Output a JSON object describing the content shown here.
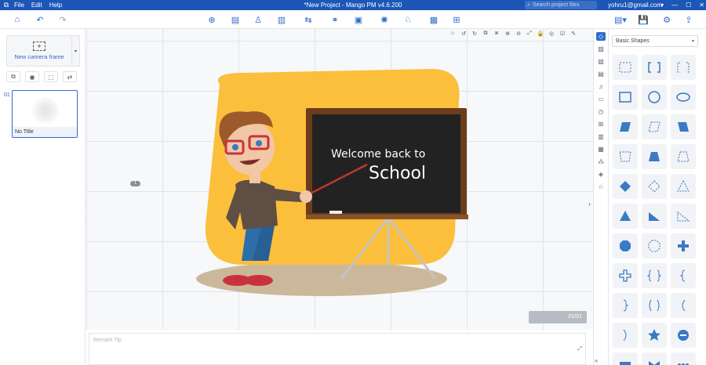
{
  "titlebar": {
    "menu": [
      "File",
      "Edit",
      "Help"
    ],
    "title": "*New Project - Mango PM  v4.6.200",
    "search_placeholder": "Search project files",
    "email": "yohru1@gmail.com"
  },
  "left_panel": {
    "new_camera_frame": "New camera frame",
    "slide_number": "01",
    "slide_title": "No Title"
  },
  "canvas": {
    "marker": "1",
    "page_counter": "01/01",
    "blackboard_line1": "Welcome back to",
    "blackboard_line2": "School",
    "colors": {
      "accent": "#2f6ccf",
      "yellow_blob": "#fbbf3c",
      "ground": "#cbb79a"
    }
  },
  "remark": {
    "placeholder": "Remark Tip"
  },
  "shapes_panel": {
    "category": "Basic Shapes",
    "shapes": [
      "rect-dashed",
      "brackets",
      "brackets-dashed",
      "rectangle",
      "circle",
      "ellipse",
      "parallelogram",
      "parallelogram-dashed",
      "trapezoid-reverse",
      "trapezoid-dashed",
      "trapezoid",
      "trapezoid-outline",
      "diamond",
      "diamond-dashed",
      "triangle-dashed",
      "triangle",
      "right-triangle",
      "right-triangle-dashed",
      "octagon",
      "octagon-dashed",
      "cross",
      "cross-outline",
      "brace-pair",
      "brace-left",
      "bracket-right",
      "paren-pair",
      "paren-left",
      "paren-right",
      "star",
      "callout-arrow",
      "rect-solid",
      "bowtie",
      "dots"
    ]
  }
}
